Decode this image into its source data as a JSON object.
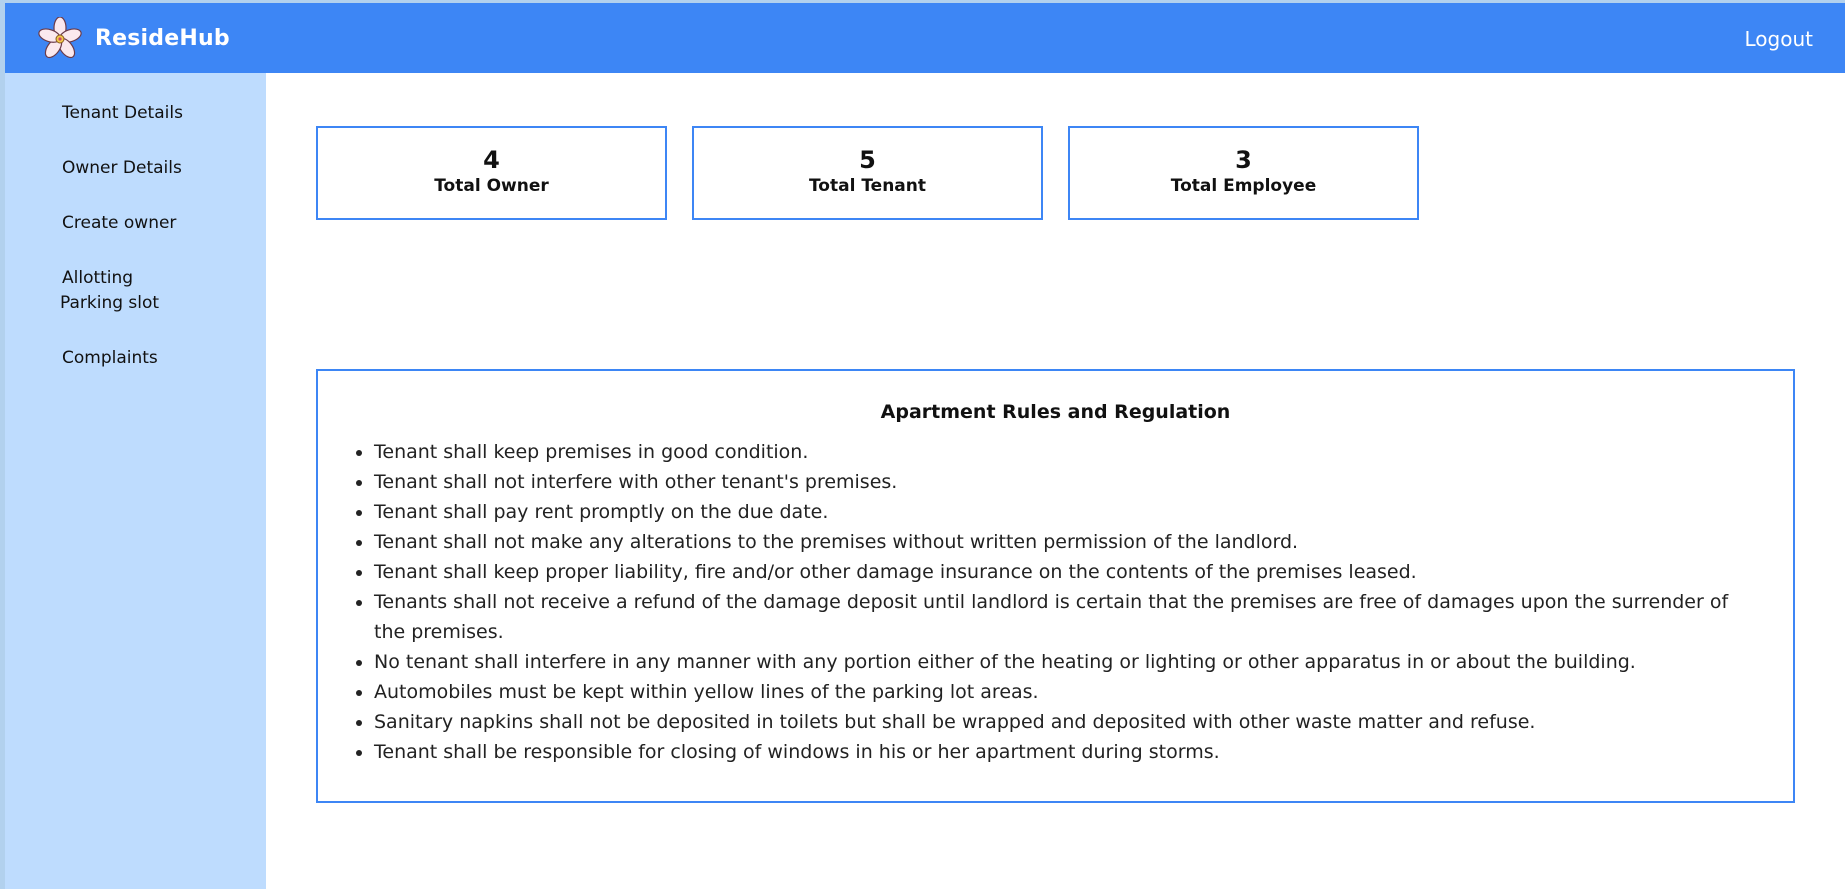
{
  "header": {
    "brand": "ResideHub",
    "logo_icon": "flower-logo-icon",
    "logout_label": "Logout",
    "colors": {
      "bar": "#3d86f5",
      "sidebar": "#bedcfe",
      "accent_border": "#3d86f5"
    }
  },
  "sidebar": {
    "items": [
      {
        "label": "Tenant Details"
      },
      {
        "label": "Owner Details"
      },
      {
        "label": "Create owner"
      },
      {
        "label_line1": "Allotting",
        "label_line2": "Parking slot"
      },
      {
        "label": "Complaints"
      }
    ]
  },
  "stats": [
    {
      "value": "4",
      "label": "Total Owner"
    },
    {
      "value": "5",
      "label": "Total Tenant"
    },
    {
      "value": "3",
      "label": "Total Employee"
    }
  ],
  "rules": {
    "title": "Apartment Rules and Regulation",
    "items": [
      "Tenant shall keep premises in good condition.",
      "Tenant shall not interfere with other tenant's premises.",
      "Tenant shall pay rent promptly on the due date.",
      "Tenant shall not make any alterations to the premises without written permission of the landlord.",
      "Tenant shall keep proper liability, fire and/or other damage insurance on the contents of the premises leased.",
      "Tenants shall not receive a refund of the damage deposit until landlord is certain that the premises are free of damages upon the surrender of the premises.",
      "No tenant shall interfere in any manner with any portion either of the heating or lighting or other apparatus in or about the building.",
      "Automobiles must be kept within yellow lines of the parking lot areas.",
      "Sanitary napkins shall not be deposited in toilets but shall be wrapped and deposited with other waste matter and refuse.",
      "Tenant shall be responsible for closing of windows in his or her apartment during storms."
    ]
  }
}
